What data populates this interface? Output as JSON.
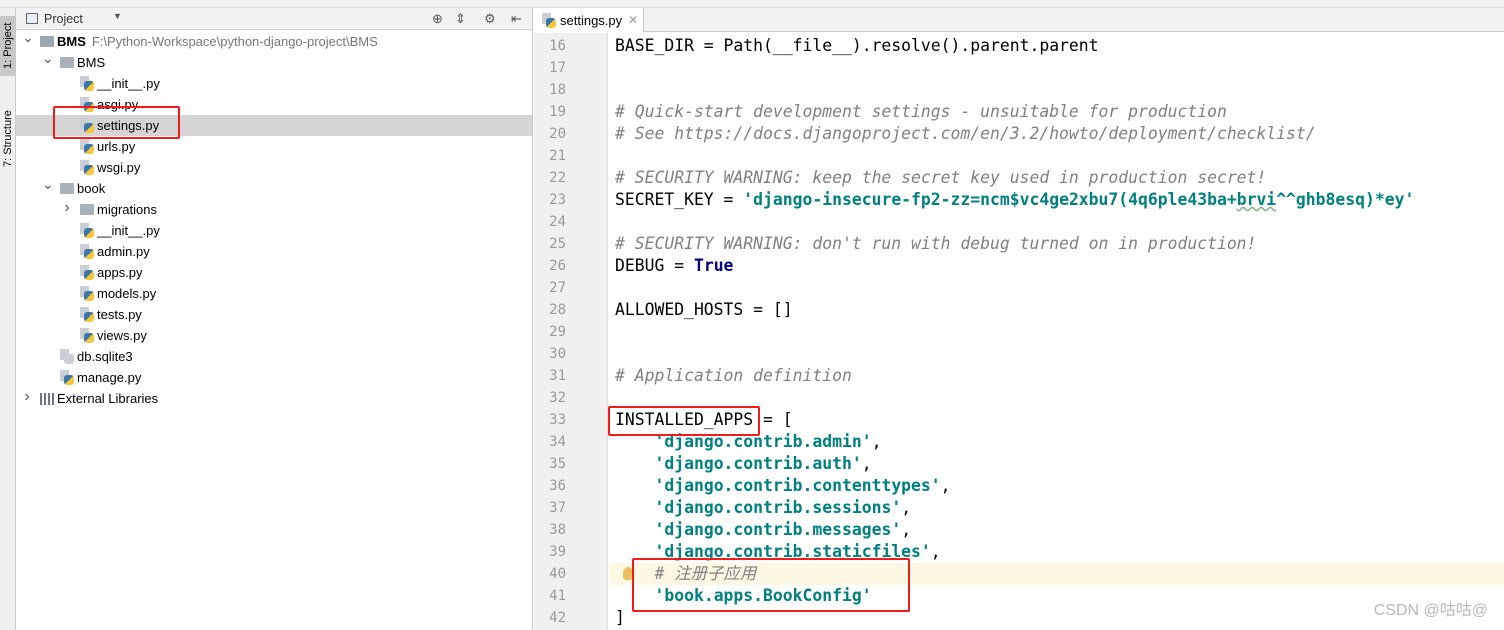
{
  "sidebar_tabs": [
    "1: Project",
    "7: Structure"
  ],
  "project_panel": {
    "title": "Project",
    "tree": [
      {
        "label": "BMS",
        "path": "F:\\Python-Workspace\\python-django-project\\BMS",
        "level": 0,
        "type": "root",
        "expanded": true
      },
      {
        "label": "BMS",
        "level": 1,
        "type": "folder",
        "expanded": true
      },
      {
        "label": "__init__.py",
        "level": 2,
        "type": "py"
      },
      {
        "label": "asgi.py",
        "level": 2,
        "type": "py"
      },
      {
        "label": "settings.py",
        "level": 2,
        "type": "py",
        "selected": true
      },
      {
        "label": "urls.py",
        "level": 2,
        "type": "py"
      },
      {
        "label": "wsgi.py",
        "level": 2,
        "type": "py"
      },
      {
        "label": "book",
        "level": 1,
        "type": "folder",
        "expanded": true
      },
      {
        "label": "migrations",
        "level": 2,
        "type": "folder",
        "expanded": false
      },
      {
        "label": "__init__.py",
        "level": 2,
        "type": "py"
      },
      {
        "label": "admin.py",
        "level": 2,
        "type": "py"
      },
      {
        "label": "apps.py",
        "level": 2,
        "type": "py"
      },
      {
        "label": "models.py",
        "level": 2,
        "type": "py"
      },
      {
        "label": "tests.py",
        "level": 2,
        "type": "py"
      },
      {
        "label": "views.py",
        "level": 2,
        "type": "py"
      },
      {
        "label": "db.sqlite3",
        "level": 1,
        "type": "db"
      },
      {
        "label": "manage.py",
        "level": 1,
        "type": "py"
      },
      {
        "label": "External Libraries",
        "level": 0,
        "type": "lib",
        "expanded": false
      }
    ]
  },
  "editor": {
    "tab_label": "settings.py",
    "highlight_line": 40,
    "lines": [
      {
        "n": "16",
        "tokens": [
          [
            "plain",
            "BASE_DIR = Path(__file__).resolve().parent.parent"
          ]
        ]
      },
      {
        "n": "17",
        "tokens": []
      },
      {
        "n": "18",
        "tokens": []
      },
      {
        "n": "19",
        "tokens": [
          [
            "comment",
            "# Quick-start development settings - unsuitable for production"
          ]
        ]
      },
      {
        "n": "20",
        "tokens": [
          [
            "comment",
            "# See https://docs.djangoproject.com/en/3.2/howto/deployment/checklist/"
          ]
        ]
      },
      {
        "n": "21",
        "tokens": []
      },
      {
        "n": "22",
        "tokens": [
          [
            "comment",
            "# SECURITY WARNING: keep the secret key used in production secret!"
          ]
        ]
      },
      {
        "n": "23",
        "tokens": [
          [
            "plain",
            "SECRET_KEY = "
          ],
          [
            "string",
            "'django-insecure-fp2-zz=ncm$vc4ge2xbu7(4q6ple43ba+"
          ],
          [
            "string warn",
            "brvi"
          ],
          [
            "string",
            "^^ghb8esq)*ey'"
          ]
        ]
      },
      {
        "n": "24",
        "tokens": []
      },
      {
        "n": "25",
        "tokens": [
          [
            "comment",
            "# SECURITY WARNING: don't run with debug turned on in production!"
          ]
        ]
      },
      {
        "n": "26",
        "tokens": [
          [
            "plain",
            "DEBUG = "
          ],
          [
            "kw",
            "True"
          ]
        ]
      },
      {
        "n": "27",
        "tokens": []
      },
      {
        "n": "28",
        "tokens": [
          [
            "plain",
            "ALLOWED_HOSTS = []"
          ]
        ]
      },
      {
        "n": "29",
        "tokens": []
      },
      {
        "n": "30",
        "tokens": []
      },
      {
        "n": "31",
        "tokens": [
          [
            "comment",
            "# Application definition"
          ]
        ]
      },
      {
        "n": "32",
        "tokens": []
      },
      {
        "n": "33",
        "tokens": [
          [
            "plain",
            "INSTALLED_APPS = ["
          ]
        ]
      },
      {
        "n": "34",
        "tokens": [
          [
            "plain",
            "    "
          ],
          [
            "string",
            "'django.contrib.admin'"
          ],
          [
            "plain",
            ","
          ]
        ]
      },
      {
        "n": "35",
        "tokens": [
          [
            "plain",
            "    "
          ],
          [
            "string",
            "'django.contrib.auth'"
          ],
          [
            "plain",
            ","
          ]
        ]
      },
      {
        "n": "36",
        "tokens": [
          [
            "plain",
            "    "
          ],
          [
            "string",
            "'django.contrib.contenttypes'"
          ],
          [
            "plain",
            ","
          ]
        ]
      },
      {
        "n": "37",
        "tokens": [
          [
            "plain",
            "    "
          ],
          [
            "string",
            "'django.contrib.sessions'"
          ],
          [
            "plain",
            ","
          ]
        ]
      },
      {
        "n": "38",
        "tokens": [
          [
            "plain",
            "    "
          ],
          [
            "string",
            "'django.contrib.messages'"
          ],
          [
            "plain",
            ","
          ]
        ]
      },
      {
        "n": "39",
        "tokens": [
          [
            "plain",
            "    "
          ],
          [
            "string",
            "'django.contrib.staticfiles'"
          ],
          [
            "plain",
            ","
          ]
        ]
      },
      {
        "n": "40",
        "tokens": [
          [
            "plain",
            "    "
          ],
          [
            "comment",
            "# 注册子应用"
          ]
        ]
      },
      {
        "n": "41",
        "tokens": [
          [
            "plain",
            "    "
          ],
          [
            "string",
            "'book.apps.BookConfig'"
          ]
        ]
      },
      {
        "n": "42",
        "tokens": [
          [
            "plain",
            "]"
          ]
        ]
      }
    ]
  },
  "annotation_color": "#f01c1c",
  "watermark": "CSDN @咕咕@"
}
